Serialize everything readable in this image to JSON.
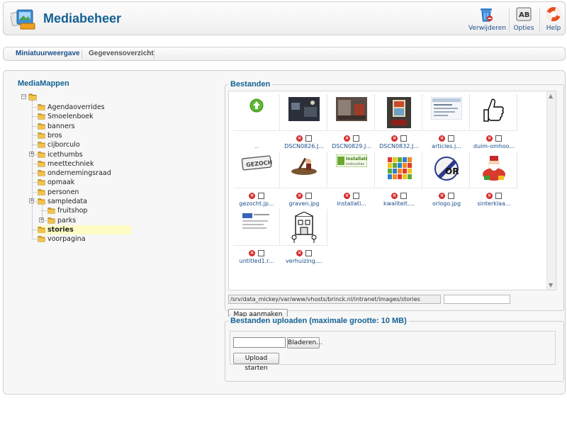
{
  "header": {
    "title": "Mediabeheer",
    "logo_icon": "media-manager-icon",
    "toolbar": [
      {
        "id": "delete",
        "label": "Verwijderen",
        "icon": "trash-icon"
      },
      {
        "id": "options",
        "label": "Opties",
        "icon": "options-icon"
      },
      {
        "id": "help",
        "label": "Help",
        "icon": "help-lifebuoy-icon"
      }
    ]
  },
  "tabs": [
    {
      "label": "Miniatuurweergave",
      "active": true
    },
    {
      "label": "Gegevensoverzicht",
      "active": false
    }
  ],
  "tree": {
    "title": "MediaMappen",
    "folders": [
      {
        "label": "Agendaoverrides",
        "level": 1,
        "expandable": false
      },
      {
        "label": "Smoelenboek",
        "level": 1,
        "expandable": false
      },
      {
        "label": "banners",
        "level": 1,
        "expandable": false
      },
      {
        "label": "bros",
        "level": 1,
        "expandable": false
      },
      {
        "label": "cijborculo",
        "level": 1,
        "expandable": false
      },
      {
        "label": "icethumbs",
        "level": 1,
        "expandable": true
      },
      {
        "label": "meettechniek",
        "level": 1,
        "expandable": false
      },
      {
        "label": "ondernemingsraad",
        "level": 1,
        "expandable": false
      },
      {
        "label": "opmaak",
        "level": 1,
        "expandable": false
      },
      {
        "label": "personen",
        "level": 1,
        "expandable": false
      },
      {
        "label": "sampledata",
        "level": 1,
        "expandable": true
      },
      {
        "label": "fruitshop",
        "level": 2,
        "expandable": false
      },
      {
        "label": "parks",
        "level": 2,
        "expandable": true
      },
      {
        "label": "stories",
        "level": 1,
        "expandable": false,
        "selected": true
      },
      {
        "label": "voorpagina",
        "level": 1,
        "expandable": false
      }
    ]
  },
  "files_panel": {
    "legend": "Bestanden",
    "items": [
      {
        "name": "..",
        "thumb": "up-arrow-icon",
        "controls": false
      },
      {
        "name": "DSCN0826.J...",
        "thumb": "photo-dark",
        "controls": true
      },
      {
        "name": "DSCN0829.J...",
        "thumb": "photo-room",
        "controls": true
      },
      {
        "name": "DSCN0832.J...",
        "thumb": "photo-poster",
        "controls": true
      },
      {
        "name": "articles.j...",
        "thumb": "screenshot",
        "controls": true
      },
      {
        "name": "duim-omhoo...",
        "thumb": "thumbs-up-clipart",
        "controls": true
      },
      {
        "name": "gezocht.jp...",
        "thumb": "gezocht-stamp",
        "controls": true
      },
      {
        "name": "graven.jpg",
        "thumb": "digging-clipart",
        "controls": true
      },
      {
        "name": "installati...",
        "thumb": "install-banner",
        "controls": true
      },
      {
        "name": "kwaliteit....",
        "thumb": "quality-chart",
        "controls": true
      },
      {
        "name": "orlogo.jpg",
        "thumb": "or-logo",
        "controls": true
      },
      {
        "name": "sinterklaa...",
        "thumb": "sinterklaas-clipart",
        "controls": true
      },
      {
        "name": "untitled1.r...",
        "thumb": "document-thumb",
        "controls": true
      },
      {
        "name": "verhuizing....",
        "thumb": "moving-clipart",
        "controls": true
      }
    ],
    "path": "/srv/data_mickey/var/www/vhosts/brinck.nl/intranet/images/stories",
    "new_folder_value": "",
    "create_folder_button": "Map aanmaken"
  },
  "upload_panel": {
    "legend": "Bestanden uploaden (maximale grootte: 10 MB)",
    "browse_button": "Bladeren...",
    "start_button": "Upload starten"
  },
  "colors": {
    "title_blue": "#146295",
    "link_blue": "#1a4e8a",
    "selected_bg": "#fffcc4",
    "delete_red": "#d62b2b"
  }
}
